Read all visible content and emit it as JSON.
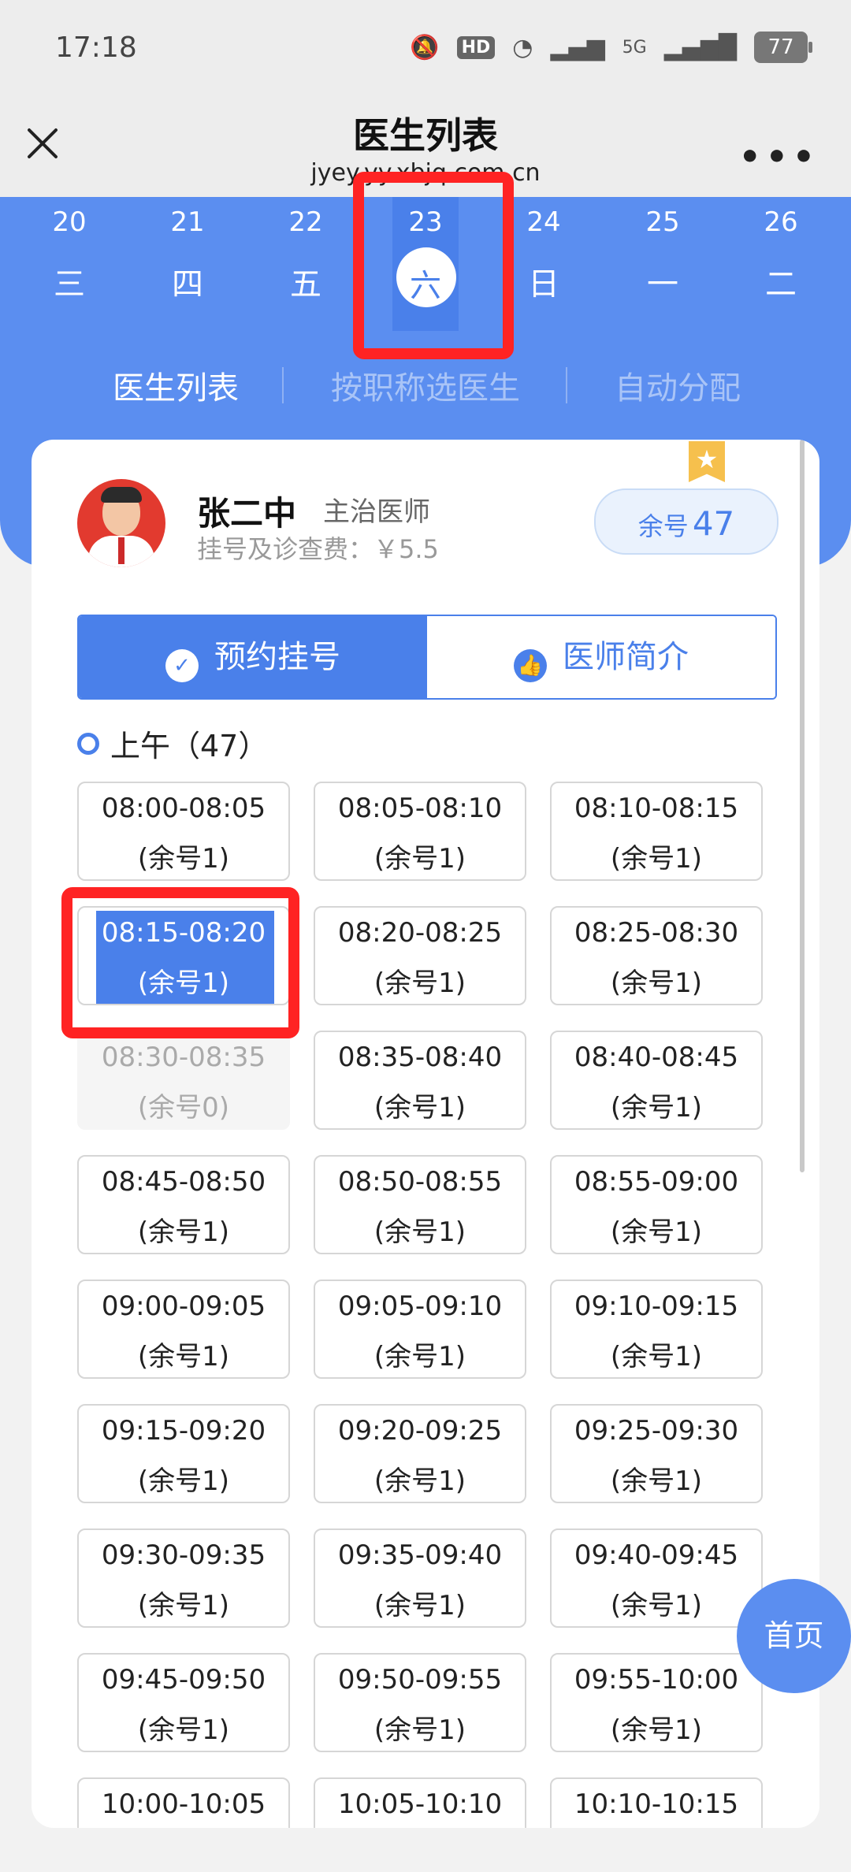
{
  "status_bar": {
    "time": "17:18",
    "hd": "HD",
    "network": "5G",
    "battery": "77"
  },
  "titlebar": {
    "title": "医生列表",
    "url": "jyey.yy.xbjq.com.cn",
    "more": "•••"
  },
  "dates": [
    {
      "day": "20",
      "weekday": "三"
    },
    {
      "day": "21",
      "weekday": "四"
    },
    {
      "day": "22",
      "weekday": "五"
    },
    {
      "day": "23",
      "weekday": "六",
      "selected": true
    },
    {
      "day": "24",
      "weekday": "日"
    },
    {
      "day": "25",
      "weekday": "一"
    },
    {
      "day": "26",
      "weekday": "二"
    }
  ],
  "filters": [
    "医生列表",
    "按职称选医生",
    "自动分配"
  ],
  "doctor": {
    "name": "张二中",
    "title": "主治医师",
    "fee": "挂号及诊查费：￥5.5",
    "remain_label": "余号",
    "remain_count": "47",
    "favorite_icon": "star-bookmark-icon"
  },
  "tabs": {
    "book": "预约挂号",
    "intro": "医师简介"
  },
  "period": {
    "label": "上午（47）"
  },
  "slots": [
    {
      "time": "08:00-08:05",
      "remain": "(余号1)"
    },
    {
      "time": "08:05-08:10",
      "remain": "(余号1)"
    },
    {
      "time": "08:10-08:15",
      "remain": "(余号1)"
    },
    {
      "time": "08:15-08:20",
      "remain": "(余号1)",
      "state": "selected"
    },
    {
      "time": "08:20-08:25",
      "remain": "(余号1)"
    },
    {
      "time": "08:25-08:30",
      "remain": "(余号1)"
    },
    {
      "time": "08:30-08:35",
      "remain": "(余号0)",
      "state": "disabled"
    },
    {
      "time": "08:35-08:40",
      "remain": "(余号1)"
    },
    {
      "time": "08:40-08:45",
      "remain": "(余号1)"
    },
    {
      "time": "08:45-08:50",
      "remain": "(余号1)"
    },
    {
      "time": "08:50-08:55",
      "remain": "(余号1)"
    },
    {
      "time": "08:55-09:00",
      "remain": "(余号1)"
    },
    {
      "time": "09:00-09:05",
      "remain": "(余号1)"
    },
    {
      "time": "09:05-09:10",
      "remain": "(余号1)"
    },
    {
      "time": "09:10-09:15",
      "remain": "(余号1)"
    },
    {
      "time": "09:15-09:20",
      "remain": "(余号1)"
    },
    {
      "time": "09:20-09:25",
      "remain": "(余号1)"
    },
    {
      "time": "09:25-09:30",
      "remain": "(余号1)"
    },
    {
      "time": "09:30-09:35",
      "remain": "(余号1)"
    },
    {
      "time": "09:35-09:40",
      "remain": "(余号1)"
    },
    {
      "time": "09:40-09:45",
      "remain": "(余号1)"
    },
    {
      "time": "09:45-09:50",
      "remain": "(余号1)"
    },
    {
      "time": "09:50-09:55",
      "remain": "(余号1)"
    },
    {
      "time": "09:55-10:00",
      "remain": "(余号1)"
    },
    {
      "time": "10:00-10:05",
      "remain": ""
    },
    {
      "time": "10:05-10:10",
      "remain": ""
    },
    {
      "time": "10:10-10:15",
      "remain": ""
    }
  ],
  "home_button": "首页",
  "colors": {
    "primary": "#4a80ea",
    "header": "#5b8ef0",
    "highlight": "#ff2323",
    "favorite": "#f6c04d"
  }
}
